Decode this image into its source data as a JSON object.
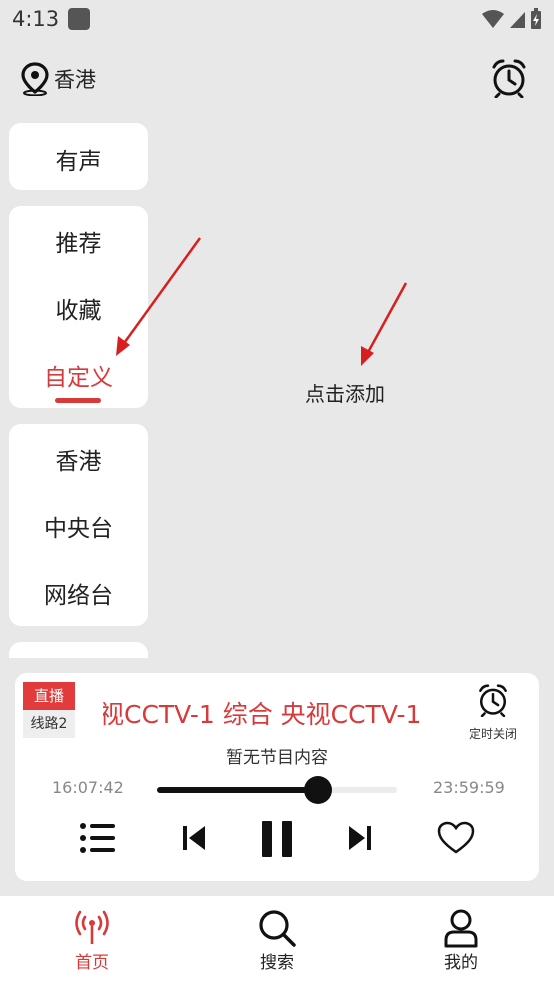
{
  "status_bar": {
    "time": "4:13"
  },
  "header": {
    "location": "香港"
  },
  "sidebar": {
    "group1": [
      "有声"
    ],
    "group2": [
      "推荐",
      "收藏",
      "自定义"
    ],
    "group3": [
      "香港",
      "中央台",
      "网络台"
    ],
    "active_item": "自定义"
  },
  "main": {
    "hint": "点击添加"
  },
  "player": {
    "live_label": "直播",
    "line_label": "线路2",
    "channel_scroll": "视CCTV-1 综合    央视CCTV-1",
    "timer_label": "定时关闭",
    "program": "暂无节目内容",
    "time_start": "16:07:42",
    "time_end": "23:59:59",
    "progress": 0.67
  },
  "tabbar": {
    "home": "首页",
    "search": "搜索",
    "mine": "我的",
    "active": "home"
  },
  "colors": {
    "accent": "#d83a3a",
    "background": "#e8e8e8"
  }
}
